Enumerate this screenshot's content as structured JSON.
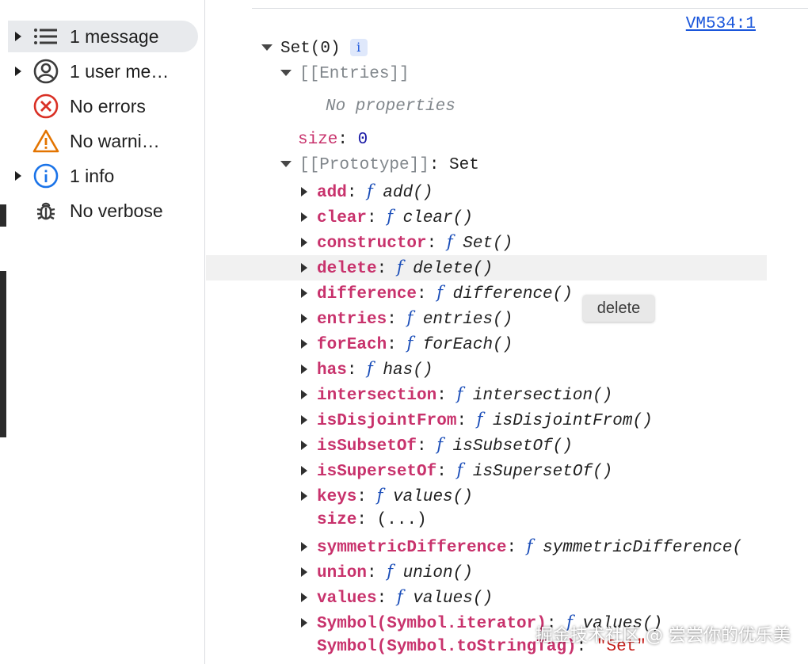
{
  "sidebar": {
    "items": [
      {
        "label": "1 message",
        "icon": "list-icon",
        "expandable": true,
        "selected": true
      },
      {
        "label": "1 user me…",
        "icon": "user-icon",
        "expandable": true,
        "selected": false
      },
      {
        "label": "No errors",
        "icon": "error-icon",
        "expandable": false,
        "selected": false
      },
      {
        "label": "No warni…",
        "icon": "warning-icon",
        "expandable": false,
        "selected": false
      },
      {
        "label": "1 info",
        "icon": "info-icon",
        "expandable": true,
        "selected": false
      },
      {
        "label": "No verbose",
        "icon": "bug-icon",
        "expandable": false,
        "selected": false
      }
    ]
  },
  "console": {
    "source_link": "VM534:1",
    "header": "Set(0)",
    "info_badge": "i",
    "entries_label": "[[Entries]]",
    "no_properties": "No properties",
    "size_key": "size",
    "size_value": "0",
    "prototype_key": "[[Prototype]]",
    "prototype_value": "Set",
    "methods": [
      {
        "key": "add",
        "fn": "add()",
        "expandable": true
      },
      {
        "key": "clear",
        "fn": "clear()",
        "expandable": true
      },
      {
        "key": "constructor",
        "fn": "Set()",
        "expandable": true
      },
      {
        "key": "delete",
        "fn": "delete()",
        "expandable": true
      },
      {
        "key": "difference",
        "fn": "difference()",
        "expandable": true
      },
      {
        "key": "entries",
        "fn": "entries()",
        "expandable": true
      },
      {
        "key": "forEach",
        "fn": "forEach()",
        "expandable": true
      },
      {
        "key": "has",
        "fn": "has()",
        "expandable": true
      },
      {
        "key": "intersection",
        "fn": "intersection()",
        "expandable": true
      },
      {
        "key": "isDisjointFrom",
        "fn": "isDisjointFrom()",
        "expandable": true
      },
      {
        "key": "isSubsetOf",
        "fn": "isSubsetOf()",
        "expandable": true
      },
      {
        "key": "isSupersetOf",
        "fn": "isSupersetOf()",
        "expandable": true
      },
      {
        "key": "keys",
        "fn": "values()",
        "expandable": true
      },
      {
        "key": "size",
        "fn": "(...)",
        "expandable": false
      },
      {
        "key": "symmetricDifference",
        "fn": "symmetricDifference(",
        "expandable": true
      },
      {
        "key": "union",
        "fn": "union()",
        "expandable": true
      },
      {
        "key": "values",
        "fn": "values()",
        "expandable": true
      },
      {
        "key": "Symbol(Symbol.iterator)",
        "fn": "values()",
        "expandable": true
      },
      {
        "key": "Symbol(Symbol.toStringTag)",
        "string_value": "\"Set\"",
        "expandable": false
      }
    ],
    "f_symbol": "f",
    "tooltip": "delete"
  },
  "watermark": "掘金技术社区 @ 尝尝你的优乐美",
  "colors": {
    "key": "#c8326c",
    "link": "#1a56db",
    "func": "#1a4db8",
    "string": "#c41a16"
  }
}
